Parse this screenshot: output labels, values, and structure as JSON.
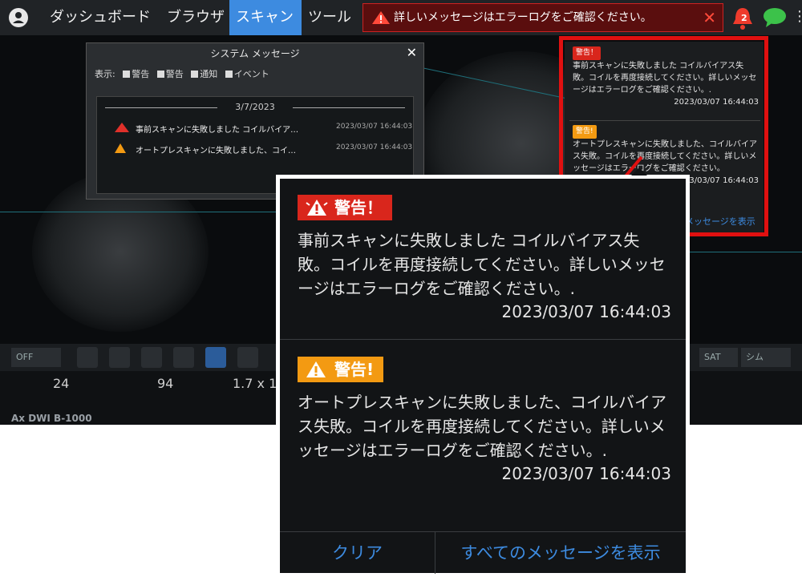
{
  "topbar": {
    "nav": [
      "ダッシュボード",
      "ブラウザ",
      "スキャン",
      "ツール"
    ],
    "active_tab": "スキャン",
    "alert_text": "詳しいメッセージはエラーログをご確認ください。",
    "notification_count": "2"
  },
  "system_dialog": {
    "title": "システム メッセージ",
    "filter_label": "表示:",
    "filters": [
      "警告",
      "警告",
      "通知",
      "イベント"
    ],
    "date_header": "3/7/2023",
    "messages": [
      {
        "text": "事前スキャンに失敗しました コイルバイア…",
        "time": "2023/03/07 16:44:03"
      },
      {
        "text": "オートプレスキャンに失敗しました、コイ…",
        "time": "2023/03/07 16:44:03"
      }
    ]
  },
  "small_panel": {
    "items": [
      {
        "badge": "警告！",
        "text": "事前スキャンに失敗しました コイルバイアス失敗。コイルを再度接続してください。詳しいメッセージはエラーログをご確認ください。.",
        "time": "2023/03/07 16:44:03"
      },
      {
        "badge": "警告!",
        "text": "オートプレスキャンに失敗しました、コイルバイアス失敗。コイルを再度接続してください。詳しいメッセージはエラーログをご確認ください。",
        "time": "2023/03/07 16:44:03"
      }
    ],
    "link": "メッセージを表示"
  },
  "popup": {
    "items": [
      {
        "badge": "警告！",
        "text": "事前スキャンに失敗しました コイルバイアス失敗。コイルを再度接続してください。詳しいメッセージはエラーログをご確認ください。.",
        "time": "2023/03/07 16:44:03"
      },
      {
        "badge": "警告!",
        "text": "オートプレスキャンに失敗しました、コイルバイアス失敗。コイルを再度接続してください。詳しいメッセージはエラーログをご確認ください。.",
        "time": "2023/03/07 16:44:03"
      }
    ],
    "clear_button": "クリア",
    "show_all_button": "すべてのメッセージを表示"
  },
  "toolbar": {
    "left_button": "OFF",
    "sat_select": "SAT",
    "sim_select": "シム"
  },
  "params": {
    "p1": "24",
    "p2": "94",
    "p3": "1.7 x 1."
  },
  "sequence_name": "Ax DWI B-1000",
  "colors": {
    "accent": "#3d8be0",
    "warning_red": "#d9261c",
    "warning_orange": "#f39a12",
    "highlight_box": "#e01010"
  }
}
